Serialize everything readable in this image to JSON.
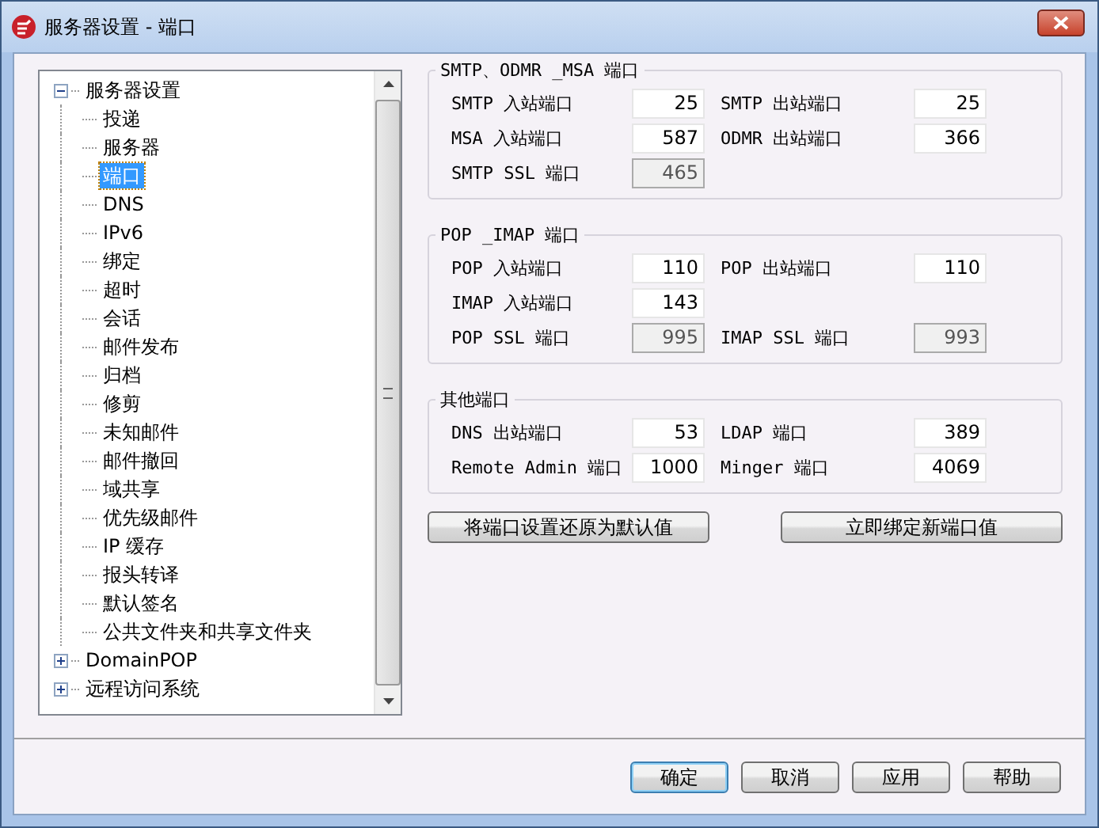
{
  "window": {
    "title": "服务器设置 - 端口"
  },
  "tree": [
    {
      "label": "服务器设置",
      "expanded": true,
      "selected": false,
      "children": [
        {
          "label": "投递",
          "selected": false
        },
        {
          "label": "服务器",
          "selected": false
        },
        {
          "label": "端口",
          "selected": true
        },
        {
          "label": "DNS",
          "selected": false
        },
        {
          "label": "IPv6",
          "selected": false
        },
        {
          "label": "绑定",
          "selected": false
        },
        {
          "label": "超时",
          "selected": false
        },
        {
          "label": "会话",
          "selected": false
        },
        {
          "label": "邮件发布",
          "selected": false
        },
        {
          "label": "归档",
          "selected": false
        },
        {
          "label": "修剪",
          "selected": false
        },
        {
          "label": "未知邮件",
          "selected": false
        },
        {
          "label": "邮件撤回",
          "selected": false
        },
        {
          "label": "域共享",
          "selected": false
        },
        {
          "label": "优先级邮件",
          "selected": false
        },
        {
          "label": "IP 缓存",
          "selected": false
        },
        {
          "label": "报头转译",
          "selected": false
        },
        {
          "label": "默认签名",
          "selected": false
        },
        {
          "label": "公共文件夹和共享文件夹",
          "selected": false
        }
      ]
    },
    {
      "label": "DomainPOP",
      "expanded": false,
      "selected": false
    },
    {
      "label": "远程访问系统",
      "expanded": false,
      "selected": false
    }
  ],
  "groups": [
    {
      "title": "SMTP、ODMR _MSA 端口",
      "rows": [
        [
          {
            "label": "SMTP 入站端口",
            "value": "25",
            "disabled": false
          },
          {
            "label": "SMTP 出站端口",
            "value": "25",
            "disabled": false
          }
        ],
        [
          {
            "label": "MSA 入站端口",
            "value": "587",
            "disabled": false
          },
          {
            "label": "ODMR 出站端口",
            "value": "366",
            "disabled": false
          }
        ],
        [
          {
            "label": "SMTP SSL 端口",
            "value": "465",
            "disabled": true
          }
        ]
      ]
    },
    {
      "title": "POP _IMAP 端口",
      "rows": [
        [
          {
            "label": "POP 入站端口",
            "value": "110",
            "disabled": false
          },
          {
            "label": "POP 出站端口",
            "value": "110",
            "disabled": false
          }
        ],
        [
          {
            "label": "IMAP 入站端口",
            "value": "143",
            "disabled": false
          }
        ],
        [
          {
            "label": "POP SSL 端口",
            "value": "995",
            "disabled": true
          },
          {
            "label": "IMAP SSL 端口",
            "value": "993",
            "disabled": true
          }
        ]
      ]
    },
    {
      "title": "其他端口",
      "rows": [
        [
          {
            "label": "DNS 出站端口",
            "value": "53",
            "disabled": false
          },
          {
            "label": "LDAP 端口",
            "value": "389",
            "disabled": false
          }
        ],
        [
          {
            "label": "Remote Admin 端口",
            "value": "1000",
            "disabled": false
          },
          {
            "label": "Minger 端口",
            "value": "4069",
            "disabled": false
          }
        ]
      ]
    }
  ],
  "actions": [
    "将端口设置还原为默认值",
    "立即绑定新端口值"
  ],
  "footer_buttons": [
    {
      "label": "确定",
      "selected": true
    },
    {
      "label": "取消",
      "selected": false
    },
    {
      "label": "应用",
      "selected": false
    },
    {
      "label": "帮助",
      "selected": false
    }
  ]
}
